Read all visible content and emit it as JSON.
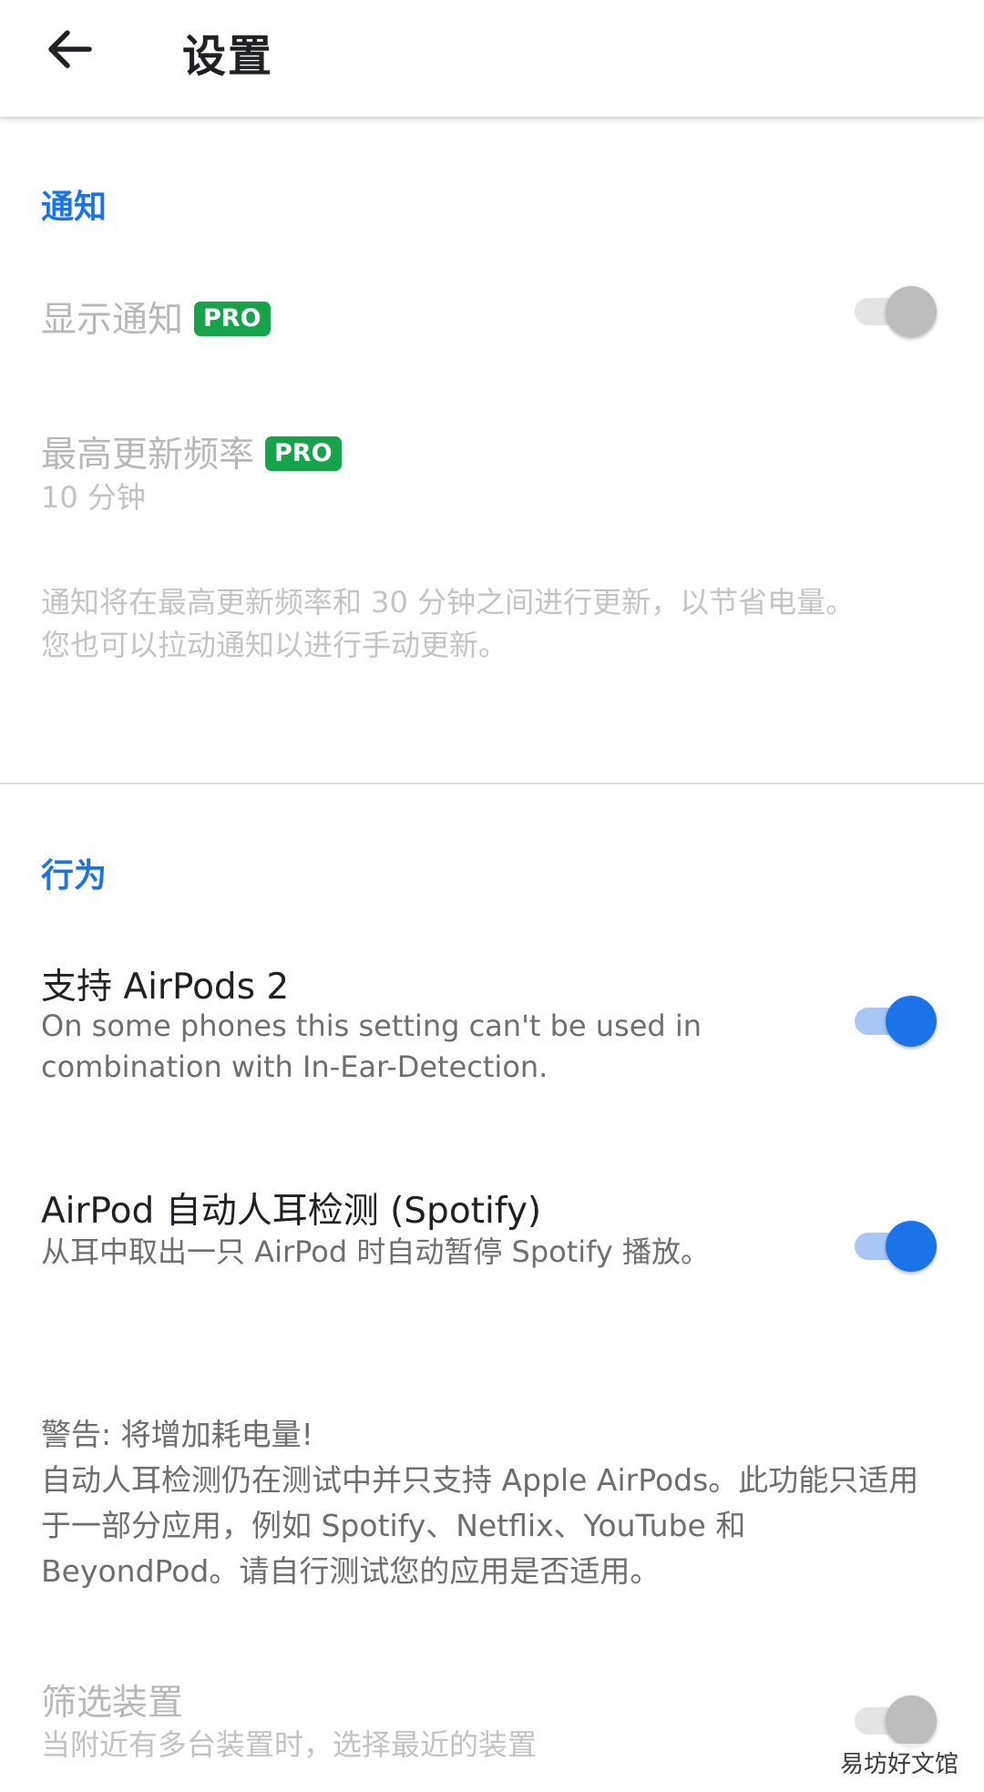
{
  "app_bar": {
    "title": "设置"
  },
  "sections": {
    "notifications": {
      "header": "通知",
      "show_notification": {
        "title": "显示通知",
        "badge": "PRO",
        "enabled": false,
        "checked": false
      },
      "max_refresh_rate": {
        "title": "最高更新频率",
        "badge": "PRO",
        "value": "10 分钟",
        "enabled": false
      },
      "note": "通知将在最高更新频率和 30 分钟之间进行更新，以节省电量。\n您也可以拉动通知以进行手动更新。"
    },
    "behavior": {
      "header": "行为",
      "airpods2": {
        "title": "支持 AirPods 2",
        "summary": "On some phones this setting can't be used in combination with In-Ear-Detection.",
        "checked": true
      },
      "auto_ear_detection": {
        "title": "AirPod 自动人耳检测 (Spotify)",
        "summary": "从耳中取出一只 AirPod 时自动暂停 Spotify 播放。",
        "checked": true
      },
      "warning": "警告: 将增加耗电量!\n自动人耳检测仍在测试中并只支持 Apple AirPods。此功能只适用于一部分应用，例如 Spotify、Netflix、YouTube 和 BeyondPod。请自行测试您的应用是否适用。",
      "filter_devices": {
        "title": "筛选装置",
        "summary": "当附近有多台装置时，选择最近的装置",
        "enabled": false,
        "checked": false
      }
    }
  },
  "watermark": "易坊好文馆",
  "colors": {
    "accent": "#1a73e8",
    "pro_badge": "#17a34a",
    "switch_track_on": "#a9c7f5",
    "switch_off_thumb": "#bdbdbd"
  },
  "icons": {
    "back": "arrow-left-icon"
  }
}
